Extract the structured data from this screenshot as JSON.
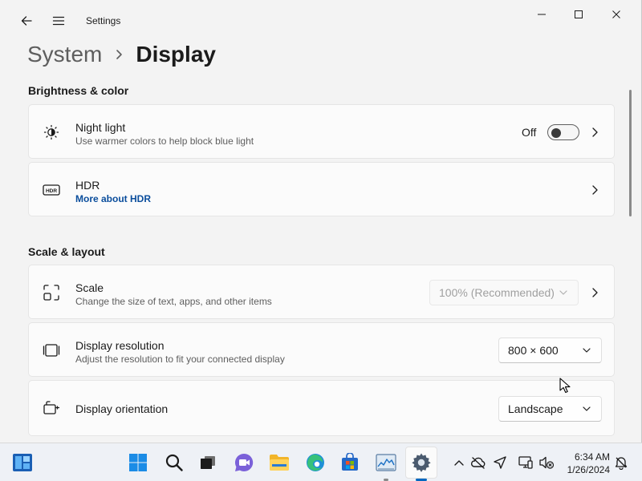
{
  "app": {
    "title": "Settings"
  },
  "breadcrumb": {
    "parent": "System",
    "current": "Display"
  },
  "sections": {
    "brightness": "Brightness & color",
    "scale_layout": "Scale & layout"
  },
  "night_light": {
    "title": "Night light",
    "description": "Use warmer colors to help block blue light",
    "state_label": "Off",
    "enabled": false
  },
  "hdr": {
    "title": "HDR",
    "link": "More about HDR",
    "icon_text": "HDR"
  },
  "scale": {
    "title": "Scale",
    "description": "Change the size of text, apps, and other items",
    "value": "100% (Recommended)"
  },
  "resolution": {
    "title": "Display resolution",
    "description": "Adjust the resolution to fit your connected display",
    "value": "800 × 600"
  },
  "orientation": {
    "title": "Display orientation",
    "value": "Landscape"
  },
  "taskbar": {
    "apps": [
      "start-icon",
      "search-icon",
      "task-view-icon",
      "teams-chat-icon",
      "file-explorer-icon",
      "edge-icon",
      "store-icon",
      "task-manager-icon",
      "settings-icon"
    ],
    "active_app": "settings-icon"
  },
  "clock": {
    "time": "6:34 AM",
    "date": "1/26/2024"
  },
  "colors": {
    "accent": "#0a4d9c",
    "indicator": "#0067c0",
    "card_bg": "#fbfbfb",
    "window_bg": "#f3f3f3"
  }
}
